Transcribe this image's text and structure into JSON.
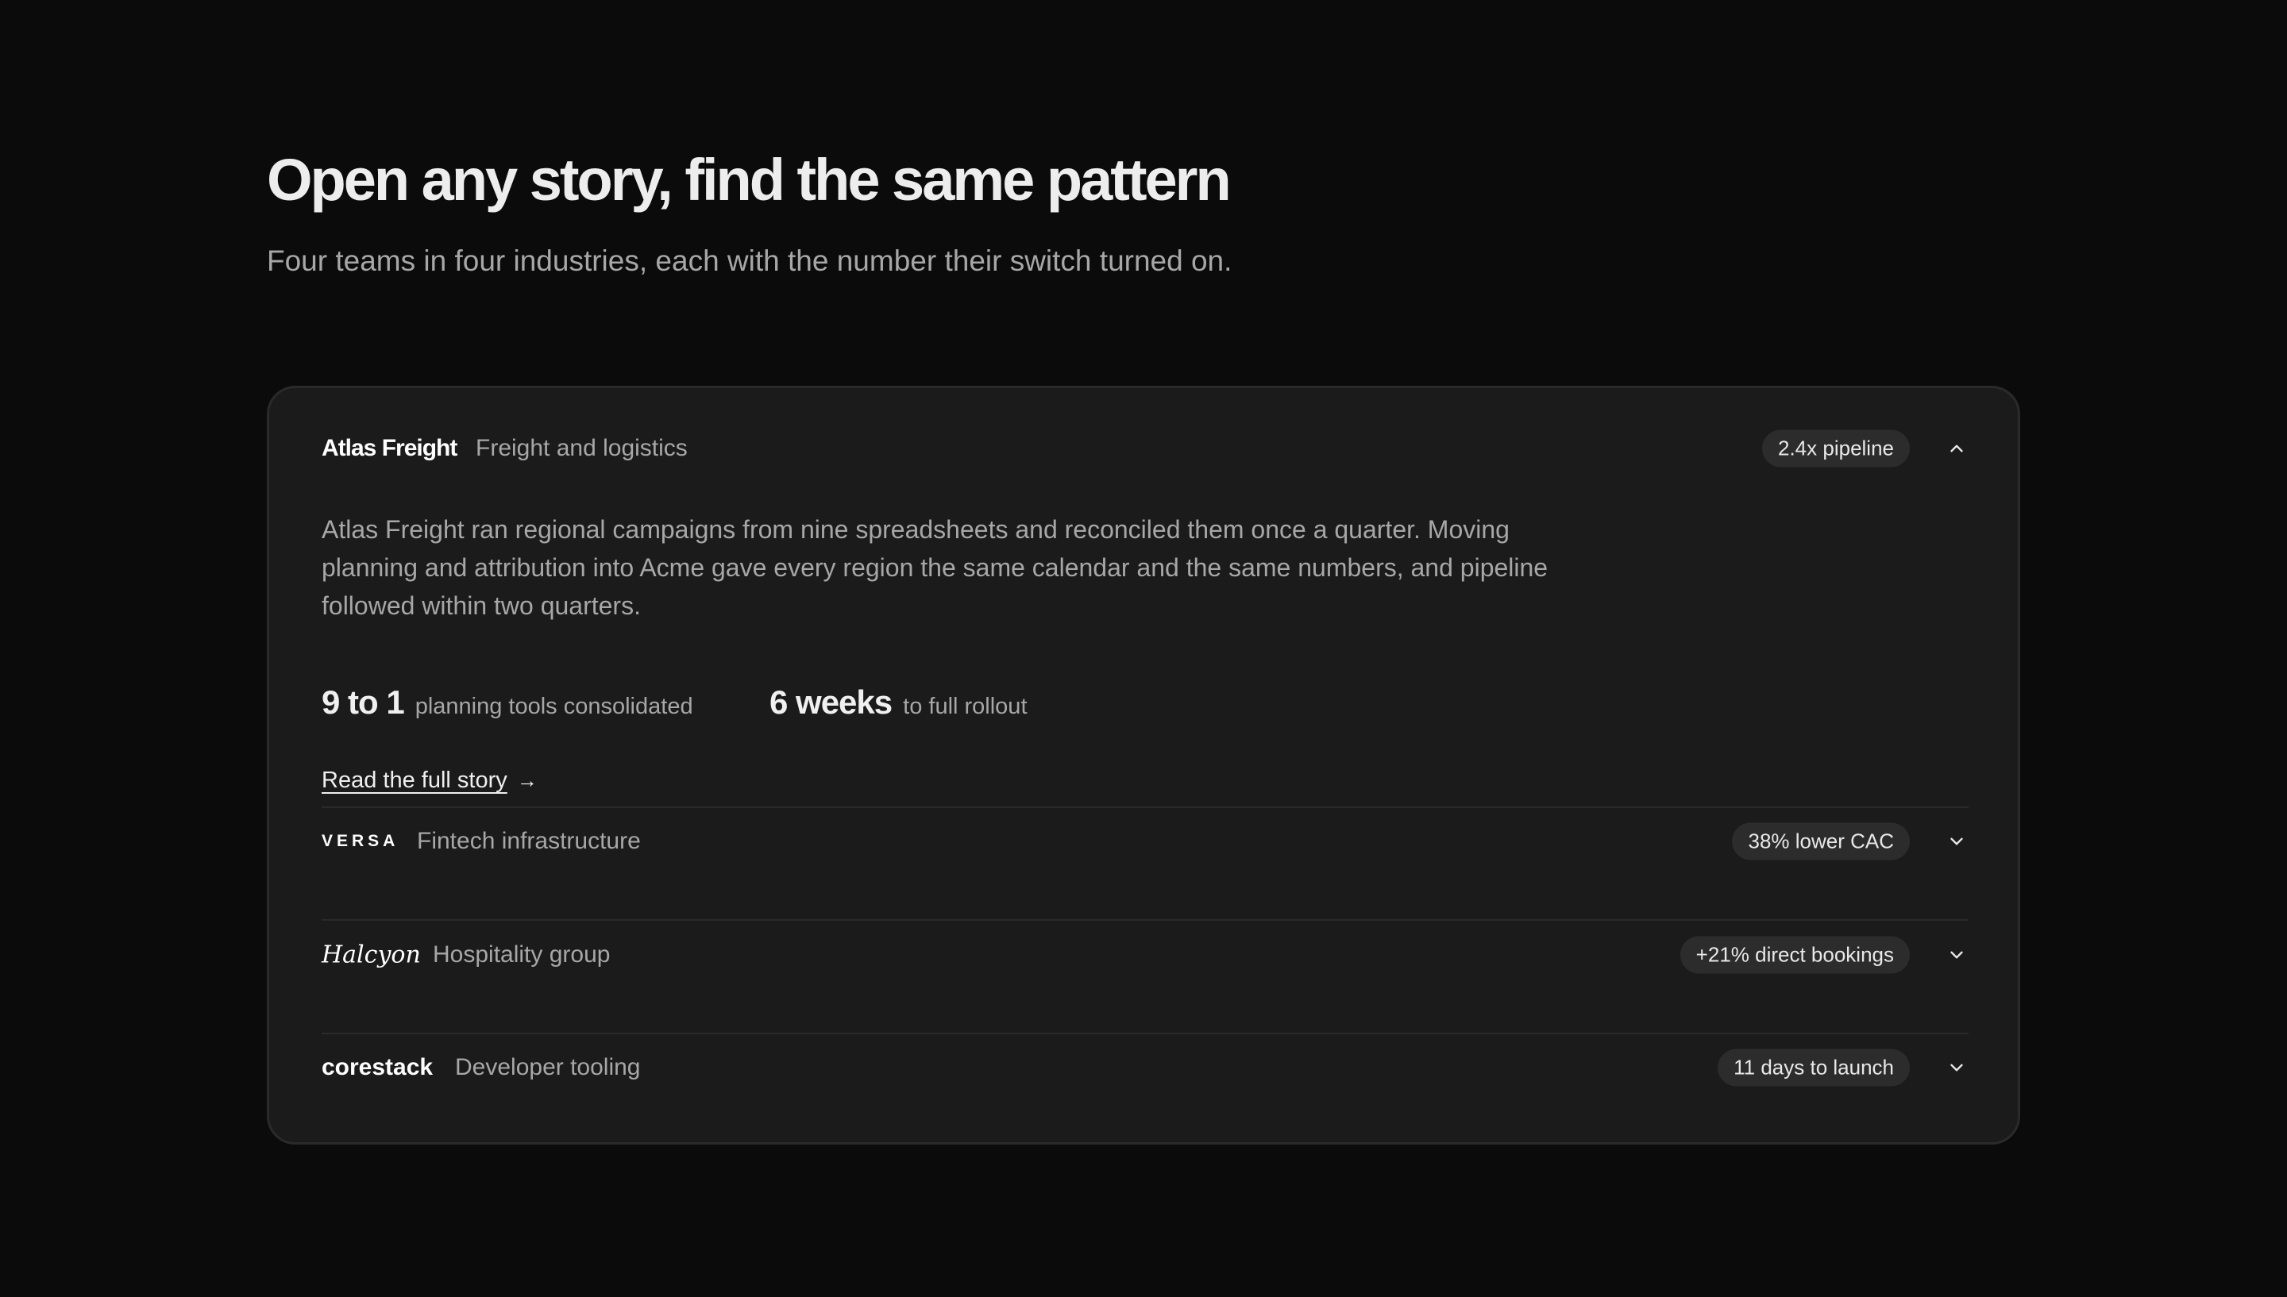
{
  "section": {
    "title": "Open any story, find the same pattern",
    "subtitle": "Four teams in four industries, each with the number their switch turned on."
  },
  "stories": [
    {
      "logo": "Atlas Freight",
      "industry": "Freight and logistics",
      "badge": "2.4x pipeline",
      "expanded": true,
      "chevron_icon": "chevron-up-icon",
      "body": "Atlas Freight ran regional campaigns from nine spreadsheets and reconciled them once a quarter. Moving planning and attribution into Acme gave every region the same calendar and the same numbers, and pipeline followed within two quarters.",
      "stats": [
        {
          "value": "9 to 1",
          "label": "planning tools consolidated"
        },
        {
          "value": "6 weeks",
          "label": "to full rollout"
        }
      ],
      "link_label": "Read the full story",
      "link_icon": "arrow-right-icon"
    },
    {
      "logo": "VERSA",
      "industry": "Fintech infrastructure",
      "badge": "38% lower CAC",
      "expanded": false,
      "chevron_icon": "chevron-down-icon"
    },
    {
      "logo": "Halcyon",
      "industry": "Hospitality group",
      "badge": "+21% direct bookings",
      "expanded": false,
      "chevron_icon": "chevron-down-icon"
    },
    {
      "logo": "corestack",
      "industry": "Developer tooling",
      "badge": "11 days to launch",
      "expanded": false,
      "chevron_icon": "chevron-down-icon"
    }
  ],
  "colors": {
    "background": "#0b0b0b",
    "card": "#1b1b1b",
    "badge_bg": "#2c2c2c",
    "muted_text": "#a7a7a7"
  }
}
